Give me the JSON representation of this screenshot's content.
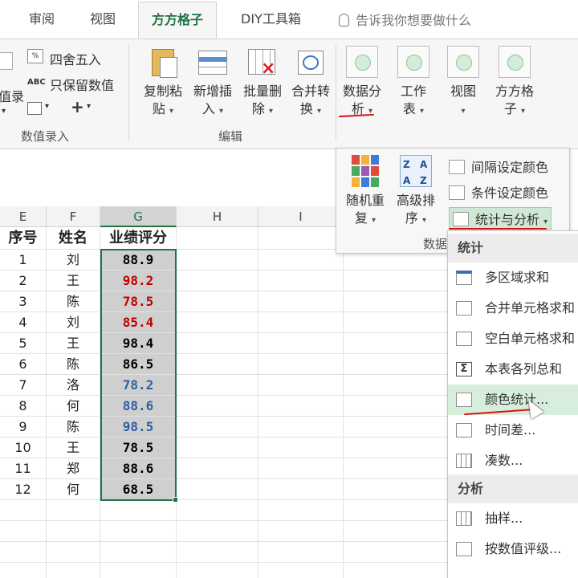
{
  "tabs": [
    {
      "label": "审阅",
      "active": false
    },
    {
      "label": "视图",
      "active": false
    },
    {
      "label": "方方格子",
      "active": true
    },
    {
      "label": "DIY工具箱",
      "active": false
    }
  ],
  "tell_me": "告诉我你想要做什么",
  "ribbon": {
    "numeric_group": {
      "label": "数值录入",
      "partial_left_label": "值录",
      "round_label": "四舍五入",
      "keep_value_label": "只保留数值",
      "abc_tag": "ABC",
      "plus_label": "+"
    },
    "edit_group": {
      "label": "编辑",
      "copy_paste": [
        "复制粘",
        "贴"
      ],
      "insert": [
        "新增插",
        "入"
      ],
      "batch_delete": [
        "批量删",
        "除"
      ],
      "merge_convert": [
        "合并转",
        "换"
      ]
    },
    "data_analysis": [
      "数据分",
      "析"
    ],
    "worksheet": [
      "工作",
      "表"
    ],
    "view": [
      "视图",
      ""
    ],
    "fangfang": [
      "方方格",
      "子"
    ]
  },
  "panel": {
    "random_repeat": [
      "随机重",
      "复"
    ],
    "advanced_sort": [
      "高级排",
      "序"
    ],
    "sort_icon_letters": [
      "Z",
      "A",
      "A",
      "Z"
    ],
    "interval_color": "间隔设定颜色",
    "condition_color": "条件设定颜色",
    "stats_analysis": "统计与分析",
    "group_label_partial": "数据"
  },
  "grid": {
    "columns": [
      "E",
      "F",
      "G",
      "H",
      "I"
    ],
    "headers": [
      "序号",
      "姓名",
      "业绩评分"
    ],
    "rows": [
      {
        "no": "1",
        "name": "刘",
        "score": "88.9",
        "color": "#000000"
      },
      {
        "no": "2",
        "name": "王",
        "score": "98.2",
        "color": "#c00000"
      },
      {
        "no": "3",
        "name": "陈",
        "score": "78.5",
        "color": "#c00000"
      },
      {
        "no": "4",
        "name": "刘",
        "score": "85.4",
        "color": "#c00000"
      },
      {
        "no": "5",
        "name": "王",
        "score": "98.4",
        "color": "#000000"
      },
      {
        "no": "6",
        "name": "陈",
        "score": "86.5",
        "color": "#000000"
      },
      {
        "no": "7",
        "name": "洛",
        "score": "78.2",
        "color": "#2e5fa3"
      },
      {
        "no": "8",
        "name": "何",
        "score": "88.6",
        "color": "#2e5fa3"
      },
      {
        "no": "9",
        "name": "陈",
        "score": "98.5",
        "color": "#2e5fa3"
      },
      {
        "no": "10",
        "name": "王",
        "score": "78.5",
        "color": "#000000"
      },
      {
        "no": "11",
        "name": "郑",
        "score": "88.6",
        "color": "#000000"
      },
      {
        "no": "12",
        "name": "何",
        "score": "68.5",
        "color": "#000000"
      }
    ]
  },
  "menu": {
    "section_stats": "统计",
    "items_stats": [
      "多区域求和",
      "合并单元格求和",
      "空白单元格求和",
      "本表各列总和",
      "颜色统计...",
      "时间差...",
      "凑数..."
    ],
    "section_analysis": "分析",
    "items_analysis": [
      "抽样...",
      "按数值评级..."
    ]
  }
}
